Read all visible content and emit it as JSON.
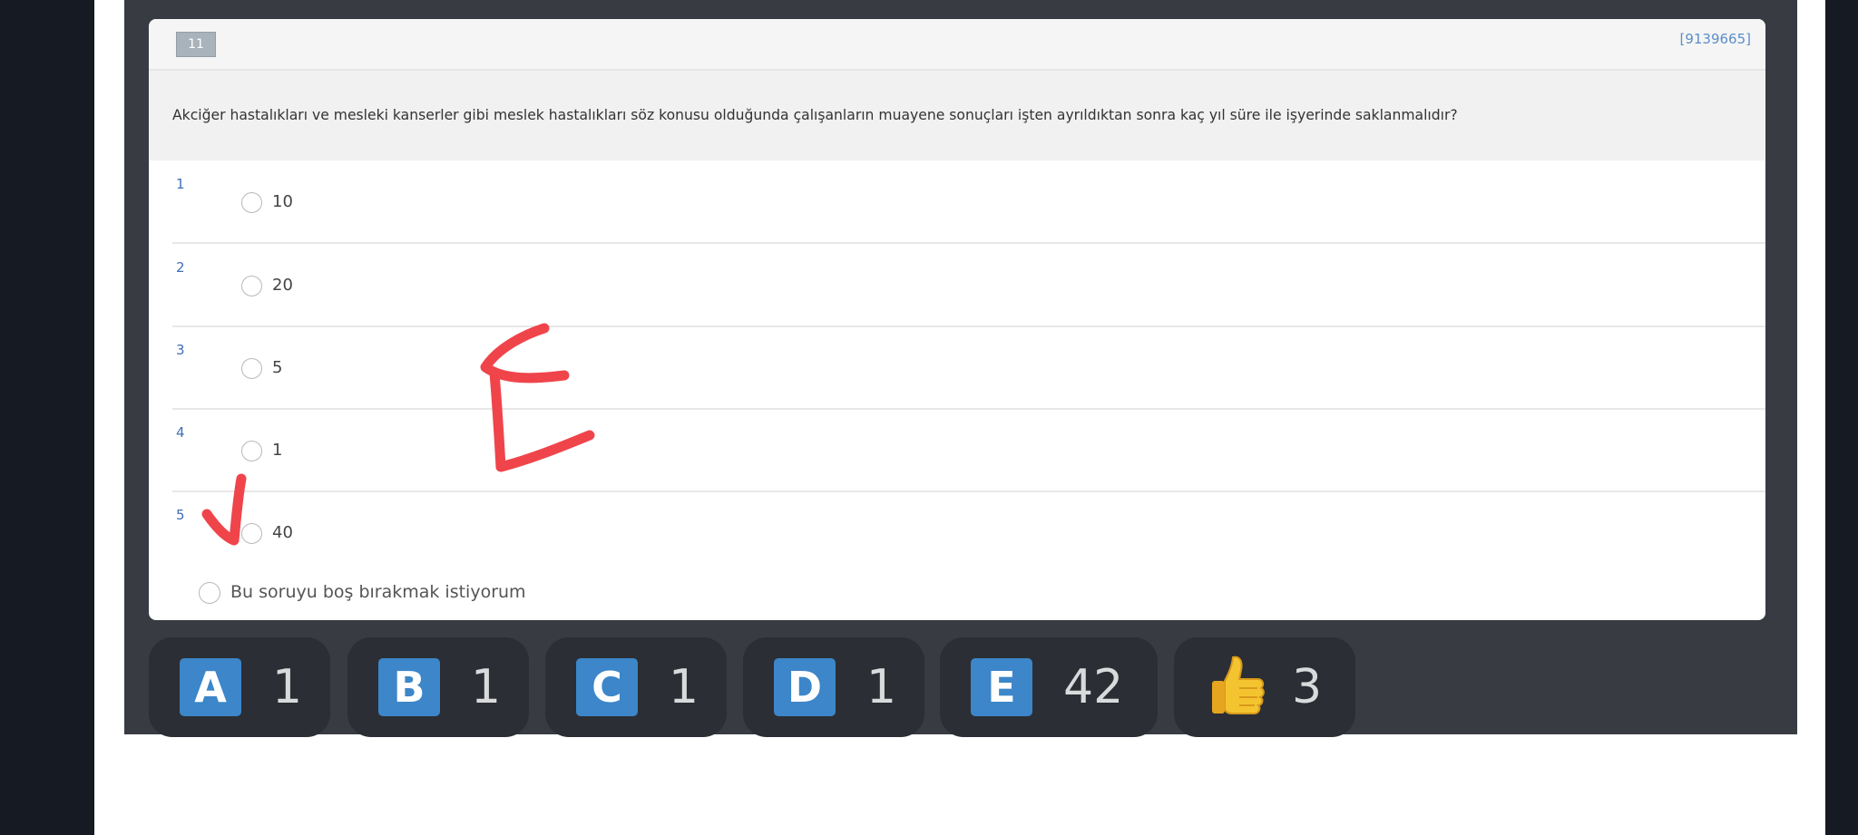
{
  "question": {
    "number": "11",
    "id": "[9139665]",
    "text": "Akciğer hastalıkları ve mesleki kanserler gibi meslek hastalıkları söz konusu olduğunda çalışanların muayene sonuçları işten ayrıldıktan sonra kaç yıl süre ile işyerinde saklanmalıdır?",
    "options": [
      {
        "num": "1",
        "label": "10"
      },
      {
        "num": "2",
        "label": "20"
      },
      {
        "num": "3",
        "label": "5"
      },
      {
        "num": "4",
        "label": "1"
      },
      {
        "num": "5",
        "label": "40"
      }
    ],
    "skip_label": "Bu soruyu boş bırakmak istiyorum"
  },
  "annotations": {
    "handwritten_letter": "E",
    "checkmark_on_option": "5",
    "color": "#f0444b"
  },
  "votes": [
    {
      "letter": "A",
      "count": "1"
    },
    {
      "letter": "B",
      "count": "1"
    },
    {
      "letter": "C",
      "count": "1"
    },
    {
      "letter": "D",
      "count": "1"
    },
    {
      "letter": "E",
      "count": "42"
    }
  ],
  "likes": {
    "icon": "thumbs-up-icon",
    "count": "3"
  },
  "colors": {
    "badge_blue": "#3c86c9",
    "dark_panel": "#383b41",
    "pill_bg": "#2b2e34",
    "link_blue": "#5b8ec7"
  }
}
